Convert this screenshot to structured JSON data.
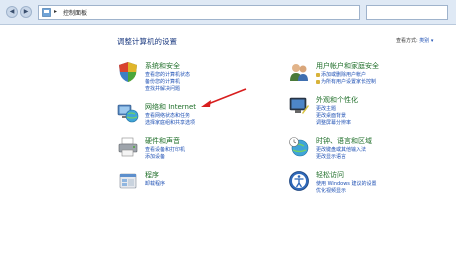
{
  "address": {
    "crumb": "控制面板",
    "separator": "▸"
  },
  "nav": {
    "back": "◀",
    "forward": "▶"
  },
  "main": {
    "title": "调整计算机的设置",
    "view_by_label": "查看方式:",
    "view_by_value": "类别 ▾"
  },
  "left_categories": [
    {
      "heading": "系统和安全",
      "links": [
        "查看您的计算机状态",
        "备份您的计算机",
        "查找并解决问题"
      ]
    },
    {
      "heading": "网络和 Internet",
      "links": [
        "查看网络状态和任务",
        "选择家庭组和共享选项"
      ]
    },
    {
      "heading": "硬件和声音",
      "links": [
        "查看设备和打印机",
        "添加设备"
      ]
    },
    {
      "heading": "程序",
      "links": [
        "卸载程序"
      ]
    }
  ],
  "right_categories": [
    {
      "heading": "用户帐户和家庭安全",
      "links": [
        "添加或删除用户帐户",
        "为所有用户设置家长控制"
      ]
    },
    {
      "heading": "外观和个性化",
      "links": [
        "更改主题",
        "更改桌面背景",
        "调整屏幕分辨率"
      ]
    },
    {
      "heading": "时钟、语言和区域",
      "links": [
        "更改键盘或其他输入法",
        "更改显示语言"
      ]
    },
    {
      "heading": "轻松访问",
      "links": [
        "使用 Windows 建议的设置",
        "优化视频显示"
      ]
    }
  ],
  "colors": {
    "heading": "#1e6e28",
    "link": "#1e50b4",
    "arrow": "#d81e1e"
  }
}
